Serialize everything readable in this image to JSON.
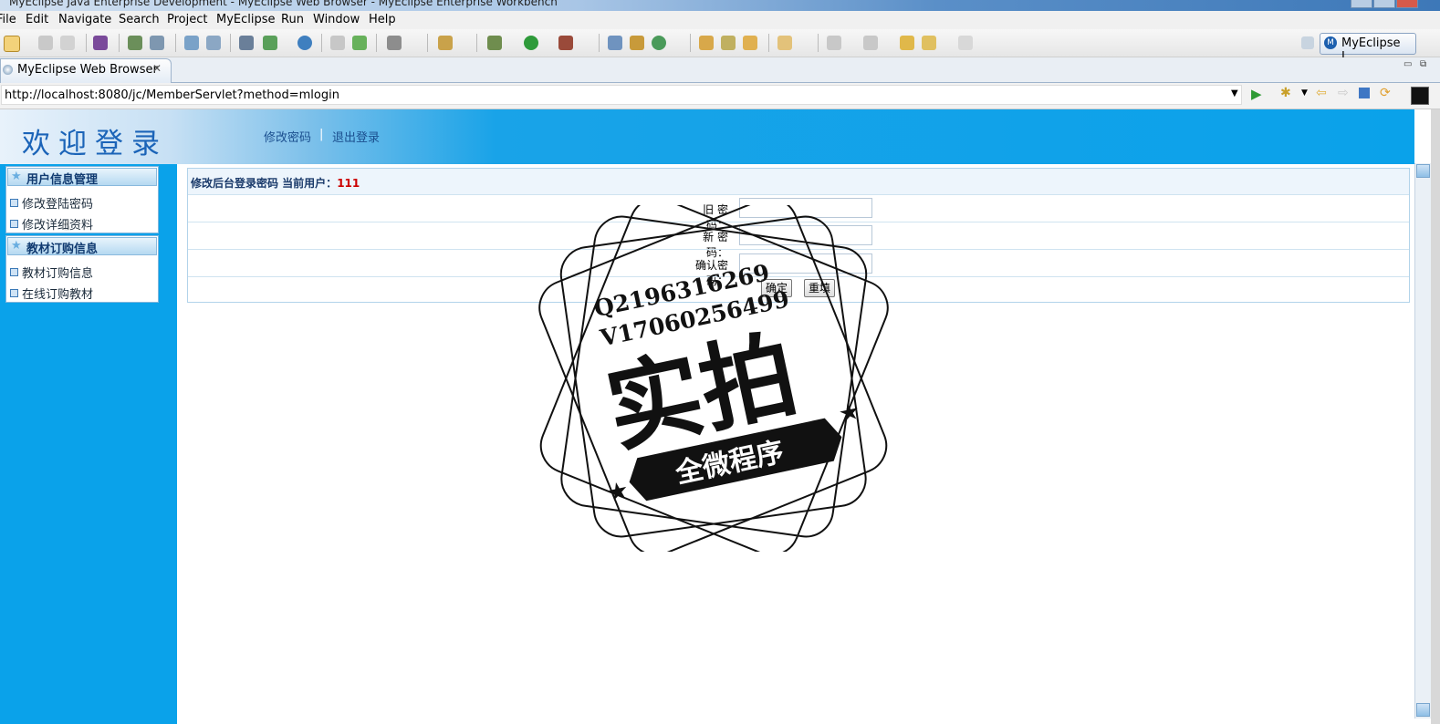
{
  "window": {
    "title": "MyEclipse Java Enterprise Development - MyEclipse Web Browser - MyEclipse Enterprise Workbench"
  },
  "menu": [
    "File",
    "Edit",
    "Navigate",
    "Search",
    "Project",
    "MyEclipse",
    "Run",
    "Window",
    "Help"
  ],
  "perspective": {
    "label": "MyEclipse J..."
  },
  "tab": {
    "label": "MyEclipse Web Browser"
  },
  "address": {
    "url": "http://localhost:8080/jc/MemberServlet?method=mlogin"
  },
  "header": {
    "title": "欢迎登录",
    "link_change_password": "修改密码",
    "separator": "|",
    "link_logout": "退出登录"
  },
  "sidebar": {
    "sections": [
      {
        "title": "用户信息管理",
        "items": [
          "修改登陆密码",
          "修改详细资料"
        ]
      },
      {
        "title": "教材订购信息",
        "items": [
          "教材订购信息",
          "在线订购教材"
        ]
      }
    ]
  },
  "form": {
    "heading": "修改后台登录密码 当前用户：",
    "current_user": "111",
    "old_password_label": "旧 密 码：",
    "new_password_label": "新 密 码：",
    "confirm_password_label": "确认密码：",
    "submit_label": "确定",
    "reset_label": "重填"
  },
  "watermark": {
    "line1": "Q2196316269",
    "line2": "V17060256499",
    "big": "实拍",
    "banner": "全微程序"
  }
}
